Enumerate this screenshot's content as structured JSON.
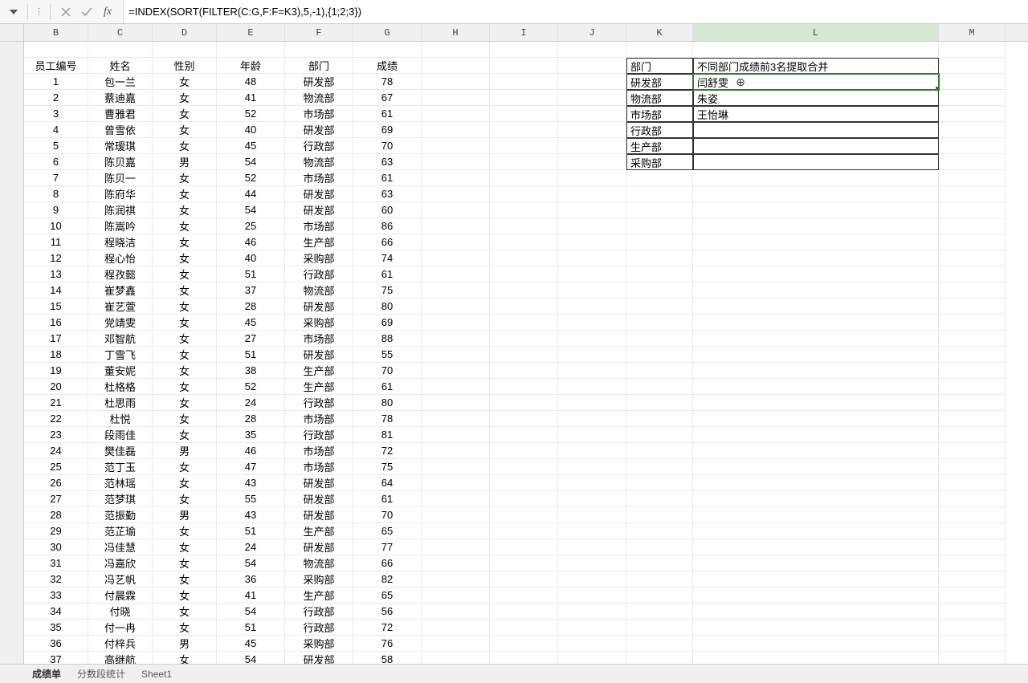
{
  "formula_bar": {
    "formula": "=INDEX(SORT(FILTER(C:G,F:F=K3),5,-1),{1;2;3})",
    "fx_label": "fx"
  },
  "columns": [
    "B",
    "C",
    "D",
    "E",
    "F",
    "G",
    "H",
    "I",
    "J",
    "K",
    "L",
    "M"
  ],
  "headers_main": {
    "B": "员工编号",
    "C": "姓名",
    "D": "性别",
    "E": "年龄",
    "F": "部门",
    "G": "成绩"
  },
  "headers_side": {
    "K": "部门",
    "L": "不同部门成绩前3名提取合并"
  },
  "side_rows": [
    {
      "K": "研发部",
      "L": "闫舒雯"
    },
    {
      "K": "物流部",
      "L": "朱姿"
    },
    {
      "K": "市场部",
      "L": "王怡琳"
    },
    {
      "K": "行政部",
      "L": ""
    },
    {
      "K": "生产部",
      "L": ""
    },
    {
      "K": "采购部",
      "L": ""
    }
  ],
  "main_rows": [
    {
      "B": "1",
      "C": "包一兰",
      "D": "女",
      "E": "48",
      "F": "研发部",
      "G": "78"
    },
    {
      "B": "2",
      "C": "蔡迪嘉",
      "D": "女",
      "E": "41",
      "F": "物流部",
      "G": "67"
    },
    {
      "B": "3",
      "C": "曹雅君",
      "D": "女",
      "E": "52",
      "F": "市场部",
      "G": "61"
    },
    {
      "B": "4",
      "C": "曾雪依",
      "D": "女",
      "E": "40",
      "F": "研发部",
      "G": "69"
    },
    {
      "B": "5",
      "C": "常瑷琪",
      "D": "女",
      "E": "45",
      "F": "行政部",
      "G": "70"
    },
    {
      "B": "6",
      "C": "陈贝嘉",
      "D": "男",
      "E": "54",
      "F": "物流部",
      "G": "63"
    },
    {
      "B": "7",
      "C": "陈贝一",
      "D": "女",
      "E": "52",
      "F": "市场部",
      "G": "61"
    },
    {
      "B": "8",
      "C": "陈府华",
      "D": "女",
      "E": "44",
      "F": "研发部",
      "G": "63"
    },
    {
      "B": "9",
      "C": "陈润祺",
      "D": "女",
      "E": "54",
      "F": "研发部",
      "G": "60"
    },
    {
      "B": "10",
      "C": "陈嵩吟",
      "D": "女",
      "E": "25",
      "F": "市场部",
      "G": "86"
    },
    {
      "B": "11",
      "C": "程晓洁",
      "D": "女",
      "E": "46",
      "F": "生产部",
      "G": "66"
    },
    {
      "B": "12",
      "C": "程心怡",
      "D": "女",
      "E": "40",
      "F": "采购部",
      "G": "74"
    },
    {
      "B": "13",
      "C": "程孜懿",
      "D": "女",
      "E": "51",
      "F": "行政部",
      "G": "61"
    },
    {
      "B": "14",
      "C": "崔梦鑫",
      "D": "女",
      "E": "37",
      "F": "物流部",
      "G": "75"
    },
    {
      "B": "15",
      "C": "崔艺萱",
      "D": "女",
      "E": "28",
      "F": "研发部",
      "G": "80"
    },
    {
      "B": "16",
      "C": "党靖雯",
      "D": "女",
      "E": "45",
      "F": "采购部",
      "G": "69"
    },
    {
      "B": "17",
      "C": "邓智航",
      "D": "女",
      "E": "27",
      "F": "市场部",
      "G": "88"
    },
    {
      "B": "18",
      "C": "丁雪飞",
      "D": "女",
      "E": "51",
      "F": "研发部",
      "G": "55"
    },
    {
      "B": "19",
      "C": "董安妮",
      "D": "女",
      "E": "38",
      "F": "生产部",
      "G": "70"
    },
    {
      "B": "20",
      "C": "杜格格",
      "D": "女",
      "E": "52",
      "F": "生产部",
      "G": "61"
    },
    {
      "B": "21",
      "C": "杜思雨",
      "D": "女",
      "E": "24",
      "F": "行政部",
      "G": "80"
    },
    {
      "B": "22",
      "C": "杜悦",
      "D": "女",
      "E": "28",
      "F": "市场部",
      "G": "78"
    },
    {
      "B": "23",
      "C": "段雨佳",
      "D": "女",
      "E": "35",
      "F": "行政部",
      "G": "81"
    },
    {
      "B": "24",
      "C": "樊佳磊",
      "D": "男",
      "E": "46",
      "F": "市场部",
      "G": "72"
    },
    {
      "B": "25",
      "C": "范丁玉",
      "D": "女",
      "E": "47",
      "F": "市场部",
      "G": "75"
    },
    {
      "B": "26",
      "C": "范林瑶",
      "D": "女",
      "E": "43",
      "F": "研发部",
      "G": "64"
    },
    {
      "B": "27",
      "C": "范梦琪",
      "D": "女",
      "E": "55",
      "F": "研发部",
      "G": "61"
    },
    {
      "B": "28",
      "C": "范振勤",
      "D": "男",
      "E": "43",
      "F": "研发部",
      "G": "70"
    },
    {
      "B": "29",
      "C": "范芷瑜",
      "D": "女",
      "E": "51",
      "F": "生产部",
      "G": "65"
    },
    {
      "B": "30",
      "C": "冯佳慧",
      "D": "女",
      "E": "24",
      "F": "研发部",
      "G": "77"
    },
    {
      "B": "31",
      "C": "冯嘉欣",
      "D": "女",
      "E": "54",
      "F": "物流部",
      "G": "66"
    },
    {
      "B": "32",
      "C": "冯艺帆",
      "D": "女",
      "E": "36",
      "F": "采购部",
      "G": "82"
    },
    {
      "B": "33",
      "C": "付晨霖",
      "D": "女",
      "E": "41",
      "F": "生产部",
      "G": "65"
    },
    {
      "B": "34",
      "C": "付晓",
      "D": "女",
      "E": "54",
      "F": "行政部",
      "G": "56"
    },
    {
      "B": "35",
      "C": "付一冉",
      "D": "女",
      "E": "51",
      "F": "行政部",
      "G": "72"
    },
    {
      "B": "36",
      "C": "付梓兵",
      "D": "男",
      "E": "45",
      "F": "采购部",
      "G": "76"
    },
    {
      "B": "37",
      "C": "高继航",
      "D": "女",
      "E": "54",
      "F": "研发部",
      "G": "58"
    }
  ],
  "sheet_tabs": [
    "成绩单",
    "分数段统计",
    "Sheet1"
  ]
}
